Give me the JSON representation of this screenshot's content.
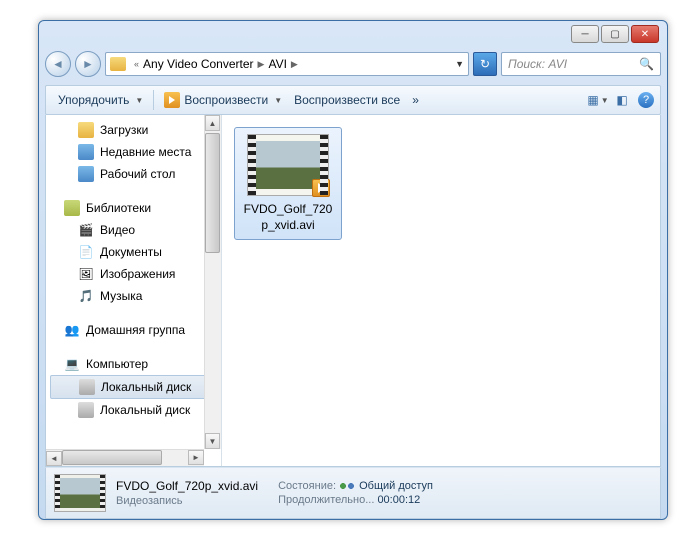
{
  "breadcrumb": {
    "prefix": "«",
    "path1": "Any Video Converter",
    "path2": "AVI"
  },
  "search": {
    "placeholder": "Поиск: AVI"
  },
  "toolbar": {
    "organize": "Упорядочить",
    "play": "Воспроизвести",
    "play_all": "Воспроизвести все",
    "more": "»"
  },
  "tree": {
    "downloads": "Загрузки",
    "recent": "Недавние места",
    "desktop": "Рабочий стол",
    "libraries": "Библиотеки",
    "video": "Видео",
    "documents": "Документы",
    "images": "Изображения",
    "music": "Музыка",
    "homegroup": "Домашняя группа",
    "computer": "Компьютер",
    "localdisk1": "Локальный диск",
    "localdisk2": "Локальный диск"
  },
  "file": {
    "name": "FVDO_Golf_720p_xvid.avi"
  },
  "details": {
    "filename": "FVDO_Golf_720p_xvid.avi",
    "type": "Видеозапись",
    "state_label": "Состояние:",
    "state_value": "Общий доступ",
    "duration_label": "Продолжительно...",
    "duration_value": "00:00:12"
  }
}
